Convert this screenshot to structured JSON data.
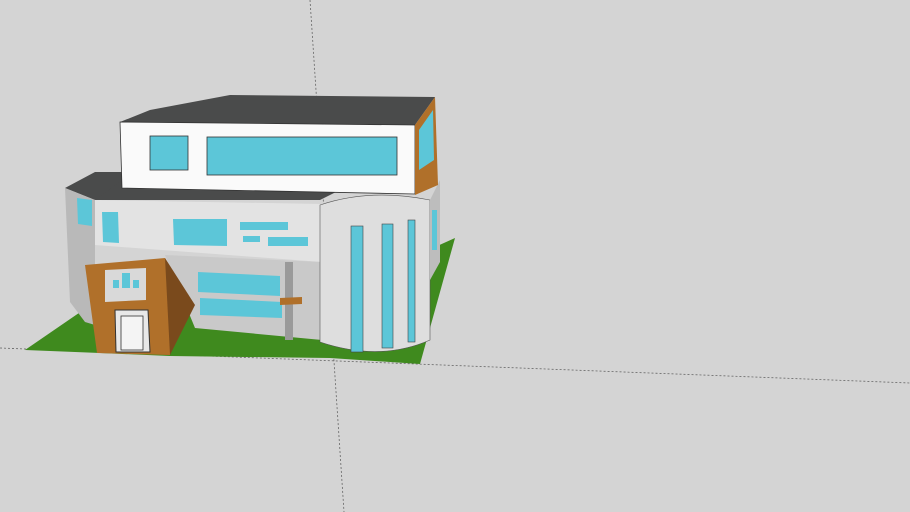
{
  "scene": {
    "type": "3d-model-viewport",
    "colors": {
      "background": "#d4d4d4",
      "ground": "#3f8a1e",
      "roof": "#4a4b4b",
      "wall_white": "#fafafa",
      "wall_gray": "#d9d9d9",
      "wall_shadow": "#b9b9b9",
      "glass": "#5cc6d8",
      "wood": "#b0702a",
      "wood_dark": "#7a4a1c",
      "axis": "#555555"
    }
  }
}
